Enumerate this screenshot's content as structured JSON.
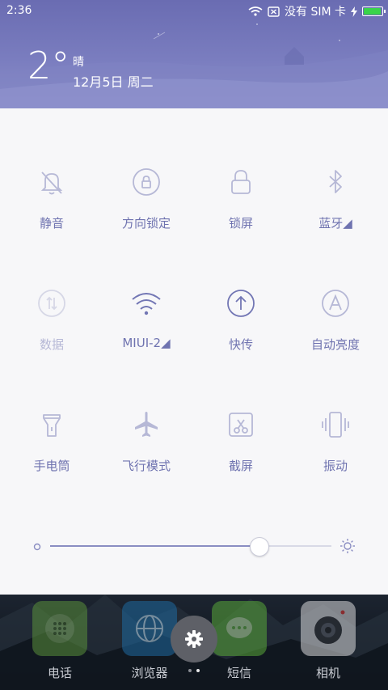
{
  "status_bar": {
    "time": "2:36",
    "sim_text": "没有 SIM 卡",
    "battery_level": 1.0,
    "battery_color": "#39d34a"
  },
  "weather": {
    "temperature": "2°",
    "condition": "晴",
    "date": "12月5日 周二"
  },
  "toggles": [
    {
      "label": "静音",
      "icon": "bell-muted-icon",
      "active": true
    },
    {
      "label": "方向锁定",
      "icon": "rotation-lock-icon",
      "active": true
    },
    {
      "label": "锁屏",
      "icon": "lock-icon",
      "active": true
    },
    {
      "label": "蓝牙◢",
      "icon": "bluetooth-icon",
      "active": true
    },
    {
      "label": "数据",
      "icon": "mobile-data-icon",
      "active": false
    },
    {
      "label": "MIUI-2◢",
      "icon": "wifi-icon",
      "active": true
    },
    {
      "label": "快传",
      "icon": "upload-icon",
      "active": true
    },
    {
      "label": "自动亮度",
      "icon": "auto-brightness-icon",
      "active": true
    },
    {
      "label": "手电筒",
      "icon": "flashlight-icon",
      "active": true
    },
    {
      "label": "飞行模式",
      "icon": "airplane-icon",
      "active": true
    },
    {
      "label": "截屏",
      "icon": "screenshot-icon",
      "active": true
    },
    {
      "label": "振动",
      "icon": "vibrate-icon",
      "active": true
    }
  ],
  "brightness": {
    "level": 0.74,
    "min_icon": "brightness-low-icon",
    "max_icon": "brightness-high-icon"
  },
  "dock": {
    "apps": [
      {
        "label": "电话",
        "icon": "phone-app-icon",
        "color": "#5a8f3c"
      },
      {
        "label": "浏览器",
        "icon": "browser-app-icon",
        "color": "#1f6aa0"
      },
      {
        "label": "短信",
        "icon": "messages-app-icon",
        "color": "#59a83a"
      },
      {
        "label": "相机",
        "icon": "camera-app-icon",
        "color": "#d8d8da"
      }
    ],
    "settings_icon": "gear-icon",
    "page_count": 2,
    "active_page": 1
  },
  "colors": {
    "accent": "#6f73b0",
    "inactive": "#b6b8d6",
    "header": "#7375b9"
  }
}
